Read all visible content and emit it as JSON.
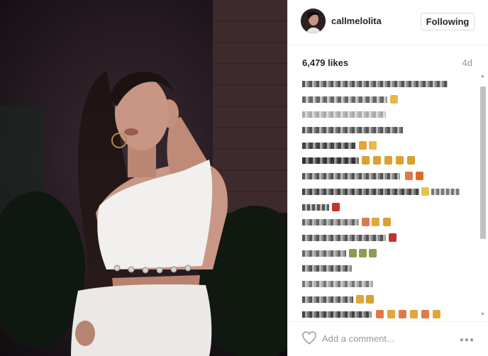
{
  "post": {
    "username": "callmelolita",
    "follow_label": "Following",
    "likes": "6,479 likes",
    "age": "4d"
  },
  "comment_box": {
    "placeholder": "Add a comment..."
  },
  "icons": {
    "like": "heart-icon",
    "more": "more-options-icon",
    "scroll_up": "triangle-up",
    "scroll_down": "triangle-down"
  },
  "colors": {
    "text": "#262626",
    "muted": "#999999",
    "border": "#efefef",
    "button_border": "#dbdbdb"
  }
}
